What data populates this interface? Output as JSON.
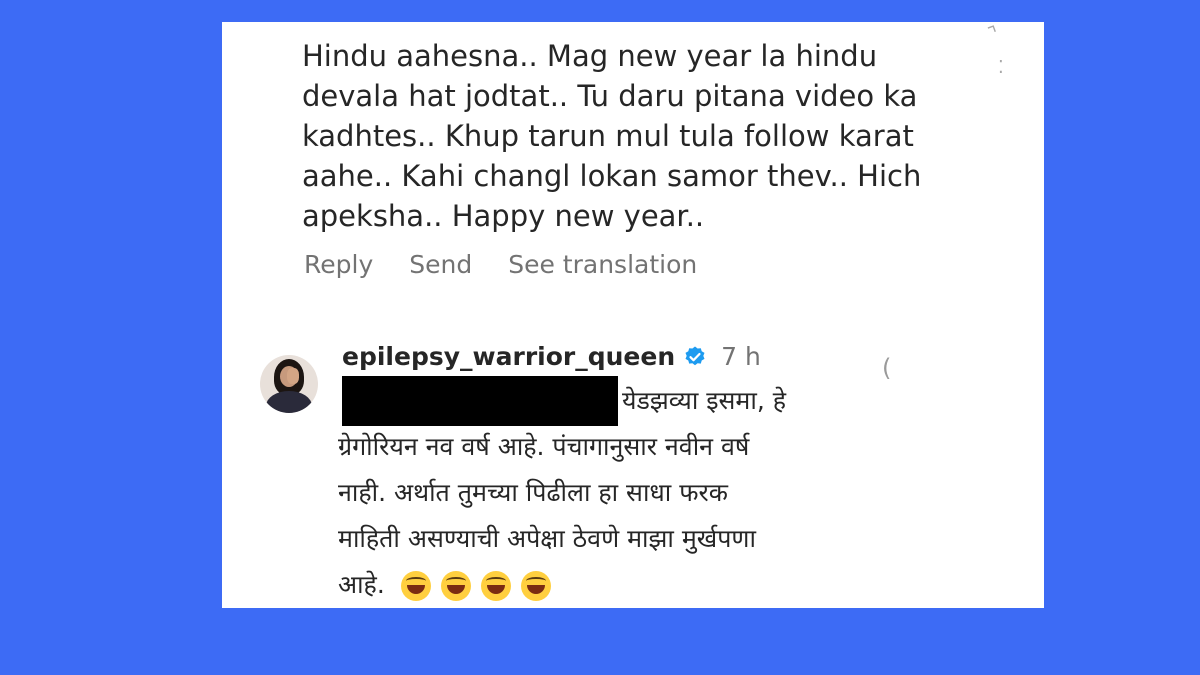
{
  "comment": {
    "text": "Hindu aahesna.. Mag new year la hindu\ndevala hat jodtat.. Tu daru pitana video ka\nkadhtes.. Khup tarun mul tula follow karat\naahe.. Kahi changl lokan samor thev.. Hich\napeksha.. Happy new year..",
    "actions": {
      "reply_label": "Reply",
      "send_label": "Send",
      "translate_label": "See translation"
    }
  },
  "reply": {
    "username": "epilepsy_warrior_queen",
    "verified": true,
    "time": "7 h",
    "lines": [
      "येडझव्या इसमा, हे",
      "ग्रेगोरियन नव वर्ष आहे. पंचागानुसार नवीन वर्ष",
      "नाही. अर्थात तुमच्या पिढीला हा साधा फरक",
      "माहिती असण्याची अपेक्षा ठेवणे माझा मुर्खपणा",
      "आहे."
    ],
    "emoji_count": 4,
    "emoji_name": "laughing-tears-emoji",
    "redacted": true
  },
  "colors": {
    "background": "#3d6bf5",
    "card": "#ffffff",
    "text": "#262626",
    "muted": "#737373",
    "verified": "#1d9bf0"
  }
}
